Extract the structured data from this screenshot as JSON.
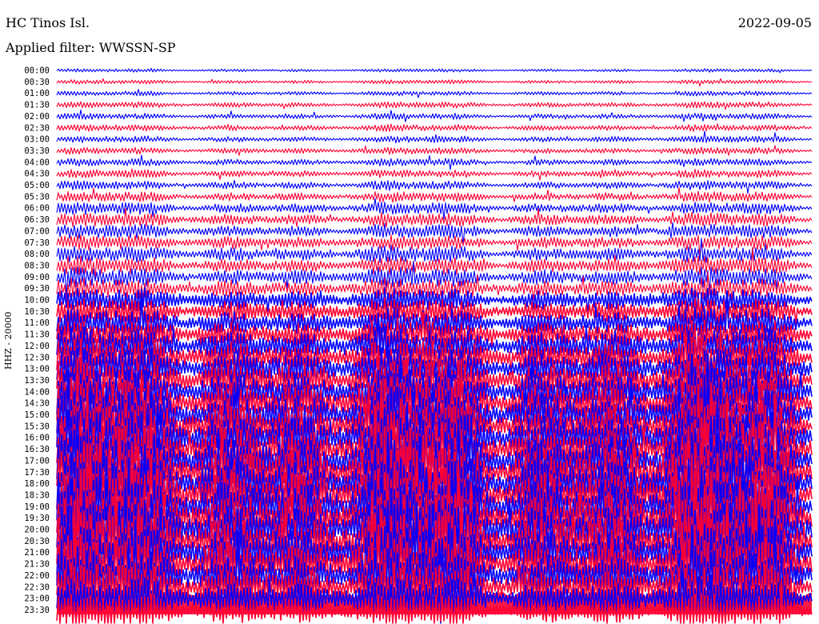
{
  "header": {
    "station": "HC Tinos Isl.",
    "date": "2022-09-05",
    "filter_text": "Applied filter: WWSSN-SP",
    "channel": "HHZ - 20000"
  },
  "colors": {
    "trace_a": "#0000ff",
    "trace_b": "#ff0033",
    "background": "#ffffff",
    "text": "#000000"
  },
  "chart_data": {
    "type": "line",
    "title": "",
    "ylabel": "HHZ - 20000",
    "row_labels": [
      "00:00",
      "00:30",
      "01:00",
      "01:30",
      "02:00",
      "02:30",
      "03:00",
      "03:30",
      "04:00",
      "04:30",
      "05:00",
      "05:30",
      "06:00",
      "06:30",
      "07:00",
      "07:30",
      "08:00",
      "08:30",
      "09:00",
      "09:30",
      "10:00",
      "10:30",
      "11:00",
      "11:30",
      "12:00",
      "12:30",
      "13:00",
      "13:30",
      "14:00",
      "14:30",
      "15:00",
      "15:30",
      "16:00",
      "16:30",
      "17:00",
      "17:30",
      "18:00",
      "18:30",
      "19:00",
      "19:30",
      "20:00",
      "20:30",
      "21:00",
      "21:30",
      "22:00",
      "22:30",
      "23:00",
      "23:30"
    ],
    "row_colors": [
      "blue",
      "red"
    ],
    "relative_amplitude": [
      0.25,
      0.3,
      0.35,
      0.45,
      0.45,
      0.5,
      0.5,
      0.5,
      0.55,
      0.6,
      0.65,
      0.75,
      0.9,
      1.0,
      1.05,
      1.1,
      1.2,
      1.3,
      1.4,
      1.5,
      1.7,
      1.9,
      2.1,
      2.3,
      2.6,
      2.9,
      3.1,
      3.3,
      3.5,
      3.7,
      3.9,
      4.0,
      4.2,
      4.3,
      4.4,
      4.5,
      4.6,
      4.7,
      4.8,
      4.8,
      4.7,
      4.6,
      4.4,
      4.2,
      4.0,
      3.6,
      3.0,
      2.5
    ],
    "grid": false
  }
}
